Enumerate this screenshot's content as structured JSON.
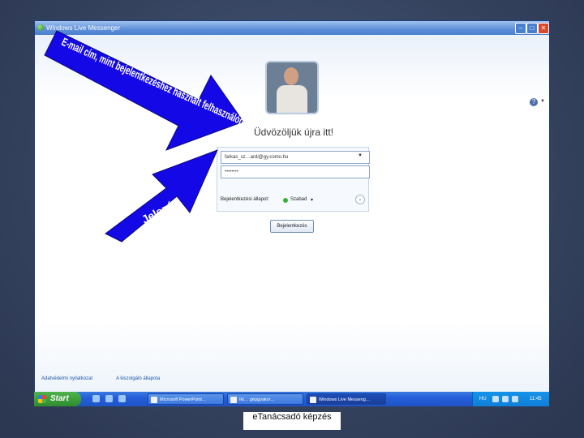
{
  "window": {
    "title": "Windows Live Messenger",
    "min_label": "–",
    "max_label": "□",
    "close_label": "✕"
  },
  "login": {
    "welcome": "Üdvözöljük újra itt!",
    "email_value": "farkas_sz…ardi@gy.como.hu",
    "password_value": "••••••••",
    "status_label": "Bejelentkezési állapot:",
    "status_value": "Szabad",
    "signin_label": "Bejelentkezés",
    "help_label": "?"
  },
  "links": {
    "privacy": "Adatvédelmi nyilatkozat",
    "status_page": "A kiszolgáló állapota"
  },
  "annotations": {
    "arrow1_text": "E-mail cím, mint bejelentkezéshez használt felhasználónév",
    "arrow2_text": "Jelszó"
  },
  "taskbar": {
    "start_label": "Start",
    "tasks": [
      "Microsoft PowerPoint…",
      "Ikt… gépgyakor…",
      "Windows Live Messeng…"
    ],
    "tray_lang": "HU",
    "clock": "11:45"
  },
  "footer": {
    "caption": "eTanácsadó képzés"
  },
  "colors": {
    "titlebar": "#4a7fcf",
    "arrow": "#1408e6",
    "arrow_text": "#ffffff"
  }
}
